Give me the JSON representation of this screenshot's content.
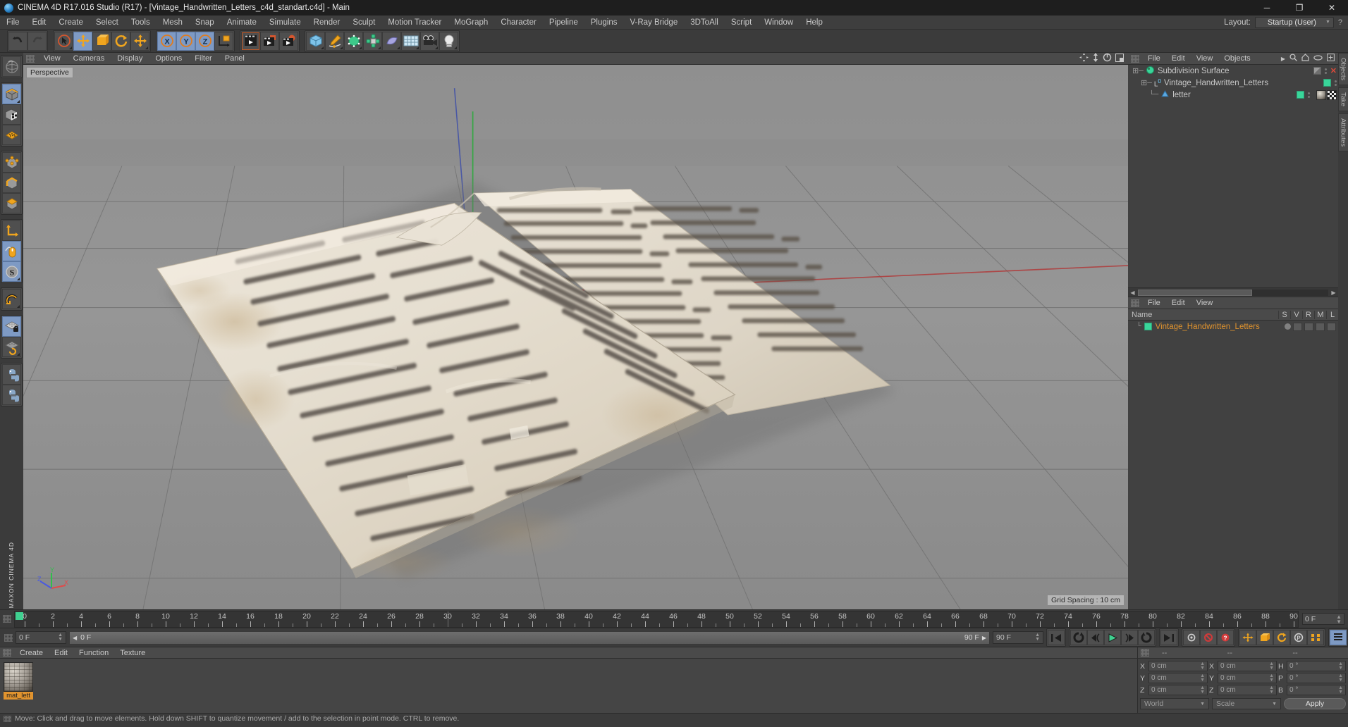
{
  "titlebar": {
    "title": "CINEMA 4D R17.016 Studio (R17) - [Vintage_Handwritten_Letters_c4d_standart.c4d] - Main",
    "minimize": "─",
    "maximize": "❐",
    "close": "✕"
  },
  "menubar": {
    "items": [
      {
        "label": "File"
      },
      {
        "label": "Edit"
      },
      {
        "label": "Create"
      },
      {
        "label": "Select"
      },
      {
        "label": "Tools"
      },
      {
        "label": "Mesh"
      },
      {
        "label": "Snap"
      },
      {
        "label": "Animate"
      },
      {
        "label": "Simulate"
      },
      {
        "label": "Render"
      },
      {
        "label": "Sculpt"
      },
      {
        "label": "Motion Tracker"
      },
      {
        "label": "MoGraph"
      },
      {
        "label": "Character"
      },
      {
        "label": "Pipeline"
      },
      {
        "label": "Plugins"
      },
      {
        "label": "V-Ray Bridge"
      },
      {
        "label": "3DToAll"
      },
      {
        "label": "Script"
      },
      {
        "label": "Window"
      },
      {
        "label": "Help"
      }
    ],
    "layout_label": "Layout:",
    "layout_value": "Startup (User)",
    "help_glyph": "?"
  },
  "viewport": {
    "menu": [
      {
        "label": "View"
      },
      {
        "label": "Cameras"
      },
      {
        "label": "Display"
      },
      {
        "label": "Options"
      },
      {
        "label": "Filter"
      },
      {
        "label": "Panel"
      }
    ],
    "perspective_label": "Perspective",
    "grid_spacing": "Grid Spacing : 10 cm",
    "axis": {
      "x": "X",
      "y": "Y",
      "z": "Z"
    }
  },
  "object_manager": {
    "menu": [
      {
        "label": "File"
      },
      {
        "label": "Edit"
      },
      {
        "label": "View"
      },
      {
        "label": "Objects"
      }
    ],
    "objects": [
      {
        "tree": "⊕─",
        "name": "Subdivision Surface",
        "indent": 0,
        "vis": "half",
        "close": "✕"
      },
      {
        "tree": "⊕─",
        "name": "Vintage_Handwritten_Letters",
        "indent": 1,
        "vis": "green"
      },
      {
        "tree": "└─",
        "name": "letter",
        "indent": 2,
        "vis": "green"
      }
    ]
  },
  "material_manager_right": {
    "menu": [
      {
        "label": "File"
      },
      {
        "label": "Edit"
      },
      {
        "label": "View"
      }
    ],
    "columns": [
      "Name",
      "S",
      "V",
      "R",
      "M",
      "L"
    ],
    "rows": [
      {
        "name": "Vintage_Handwritten_Letters"
      }
    ]
  },
  "side_tabs": [
    {
      "label": "Objects"
    },
    {
      "label": "Take"
    },
    {
      "label": "Attributes"
    }
  ],
  "timeline": {
    "ticks": [
      0,
      2,
      4,
      6,
      8,
      10,
      12,
      14,
      16,
      18,
      20,
      22,
      24,
      26,
      28,
      30,
      32,
      34,
      36,
      38,
      40,
      42,
      44,
      46,
      48,
      50,
      52,
      54,
      56,
      58,
      60,
      62,
      64,
      66,
      68,
      70,
      72,
      74,
      76,
      78,
      80,
      82,
      84,
      86,
      88,
      90
    ],
    "min_frame": 0,
    "max_frame": 90,
    "current_frame_field": "0 F"
  },
  "transport": {
    "start_field": "0 F",
    "range_start": "0 F",
    "range_end": "90 F",
    "end_field": "90 F",
    "buttons": [
      {
        "name": "go-to-start",
        "glyph": "⏮"
      },
      {
        "name": "play-backwards",
        "glyph": "↺"
      },
      {
        "name": "previous-frame",
        "glyph": "◁"
      },
      {
        "name": "play-forward",
        "glyph": "▶"
      },
      {
        "name": "next-frame",
        "glyph": "▷"
      },
      {
        "name": "loop",
        "glyph": "↻"
      },
      {
        "name": "go-to-end",
        "glyph": "⏭"
      }
    ]
  },
  "material_manager_bottom": {
    "menu": [
      {
        "label": "Create"
      },
      {
        "label": "Edit"
      },
      {
        "label": "Function"
      },
      {
        "label": "Texture"
      }
    ],
    "materials": [
      {
        "name": "mat_lett"
      }
    ]
  },
  "coordinates": {
    "headers": [
      "--",
      "--",
      "--"
    ],
    "rows": [
      {
        "l1": "X",
        "v1": "0 cm",
        "l2": "X",
        "v2": "0 cm",
        "l3": "H",
        "v3": "0 °"
      },
      {
        "l1": "Y",
        "v1": "0 cm",
        "l2": "Y",
        "v2": "0 cm",
        "l3": "P",
        "v3": "0 °"
      },
      {
        "l1": "Z",
        "v1": "0 cm",
        "l2": "Z",
        "v2": "0 cm",
        "l3": "B",
        "v3": "0 °"
      }
    ],
    "system": "World",
    "mode": "Scale",
    "apply": "Apply"
  },
  "statusbar": {
    "text": "Move: Click and drag to move elements. Hold down SHIFT to quantize movement / add to the selection in point mode. CTRL to remove."
  },
  "branding": {
    "maxon": "MAXON",
    "c4d": "CINEMA 4D"
  },
  "colors": {
    "accent_orange": "#e0932e",
    "green": "#39d69a",
    "selected_blue": "#7e9ac4",
    "panel_bg": "#3b3b3b"
  }
}
